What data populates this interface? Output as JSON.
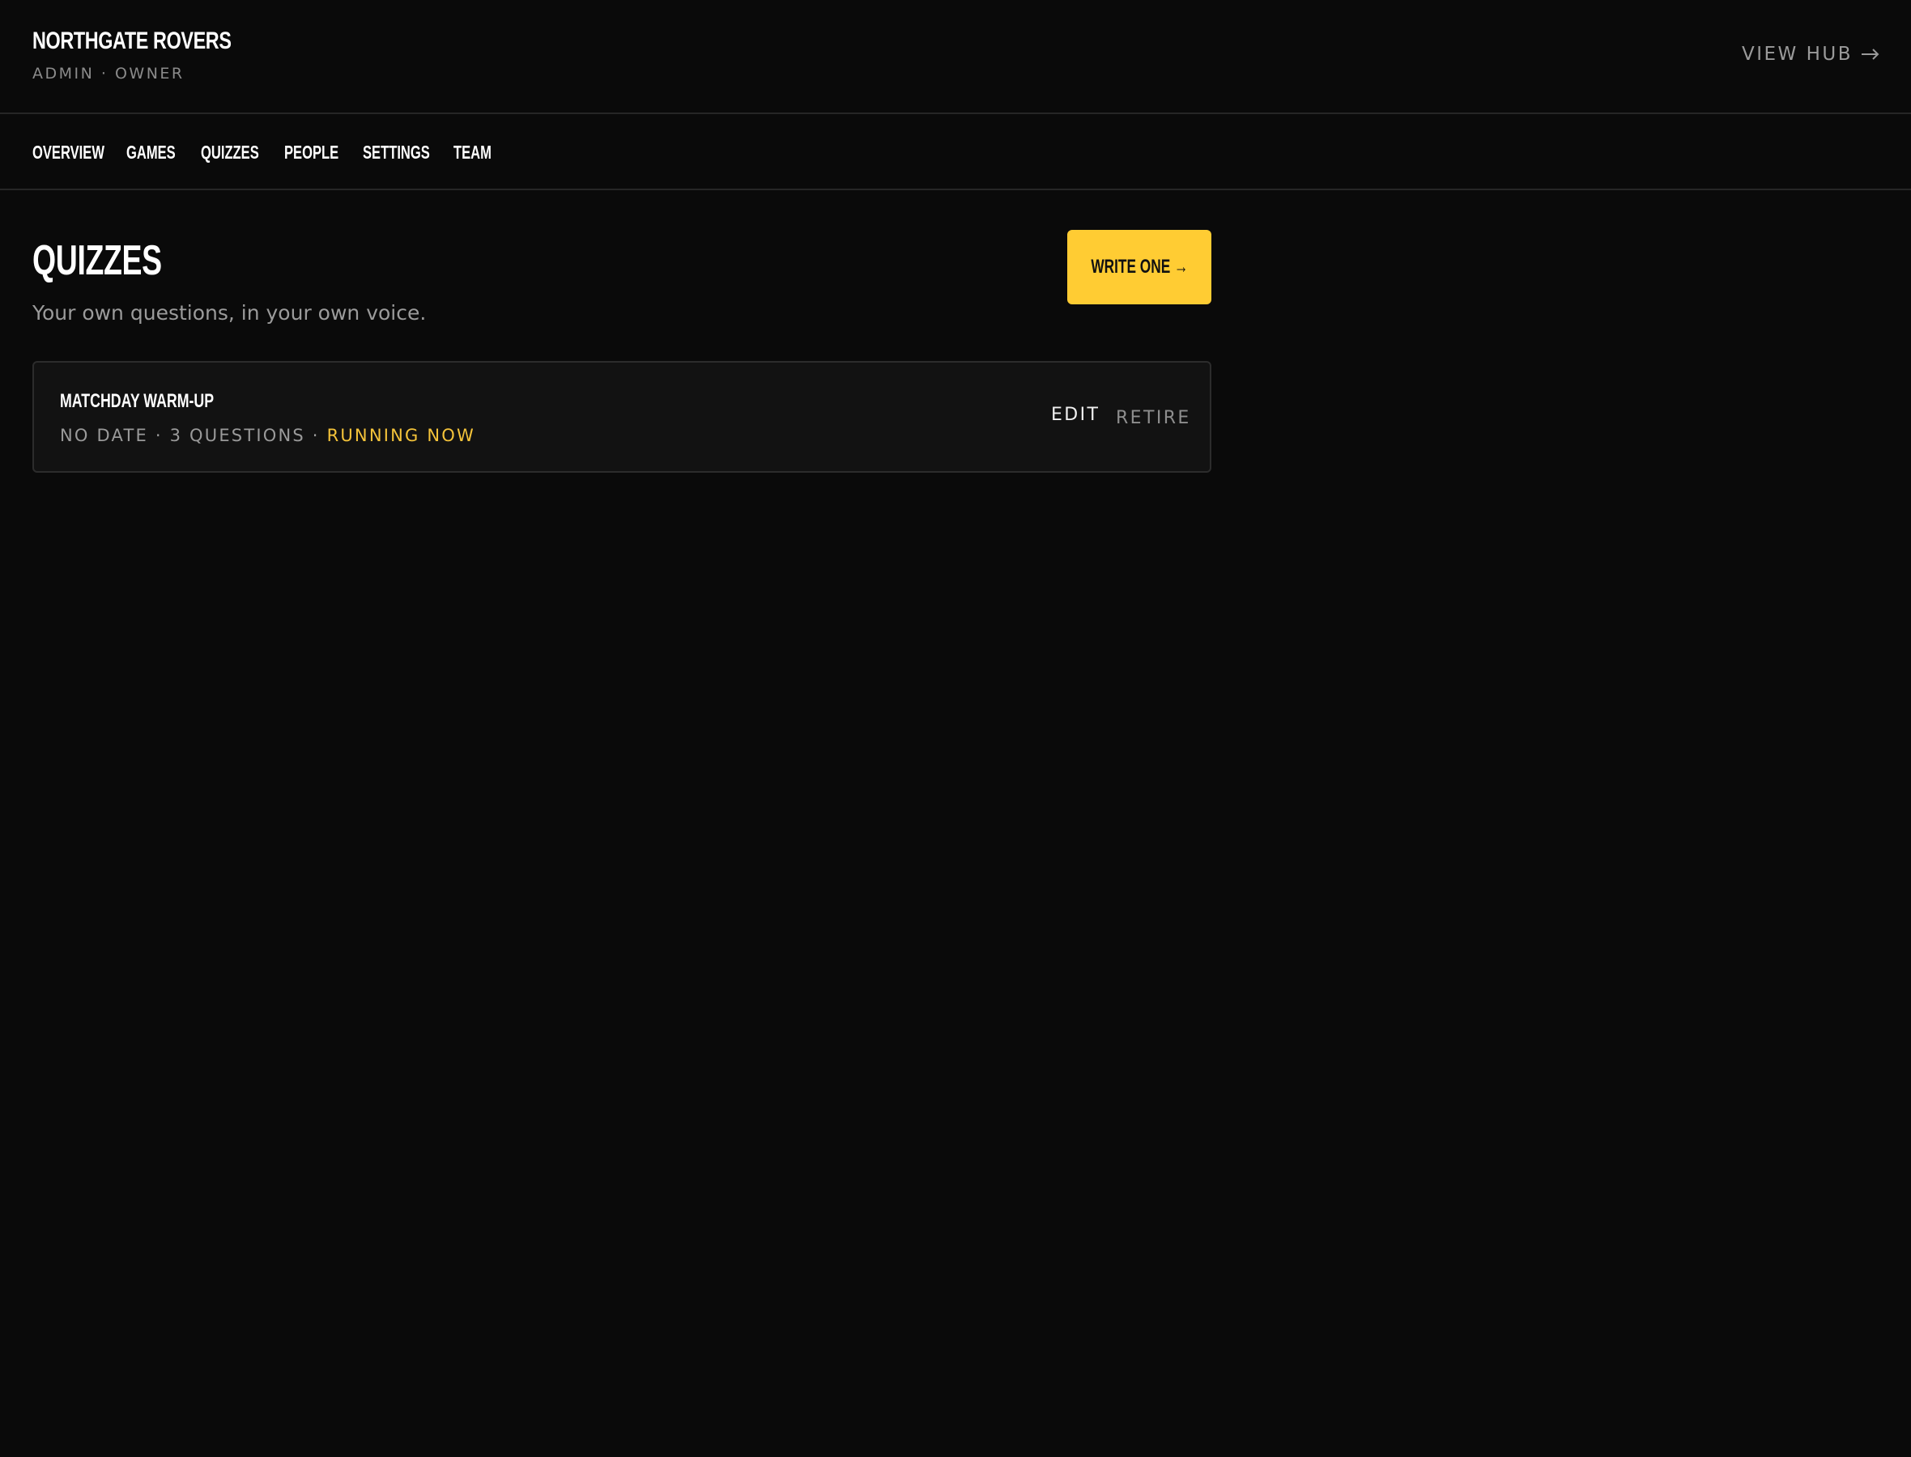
{
  "header": {
    "team_name": "NORTHGATE ROVERS",
    "role": "ADMIN · OWNER",
    "view_hub_label": "VIEW HUB"
  },
  "nav": {
    "items": [
      {
        "label": "OVERVIEW"
      },
      {
        "label": "GAMES"
      },
      {
        "label": "QUIZZES"
      },
      {
        "label": "PEOPLE"
      },
      {
        "label": "SETTINGS"
      },
      {
        "label": "TEAM"
      }
    ]
  },
  "page": {
    "title": "QUIZZES",
    "subtitle": "Your own questions, in your own voice.",
    "write_button_label": "WRITE ONE →"
  },
  "quizzes": [
    {
      "title": "MATCHDAY WARM-UP",
      "date": "NO DATE",
      "question_count": "3 QUESTIONS",
      "separator": " · ",
      "status": "RUNNING NOW",
      "edit_label": "EDIT",
      "retire_label": "RETIRE"
    }
  ],
  "colors": {
    "background": "#0a0a0a",
    "accent": "#ffcc33",
    "status_running": "#f5c43a",
    "muted_text": "#9a9a9a",
    "border": "#262626"
  },
  "icons": {
    "view_hub": "arrow-right-icon"
  }
}
